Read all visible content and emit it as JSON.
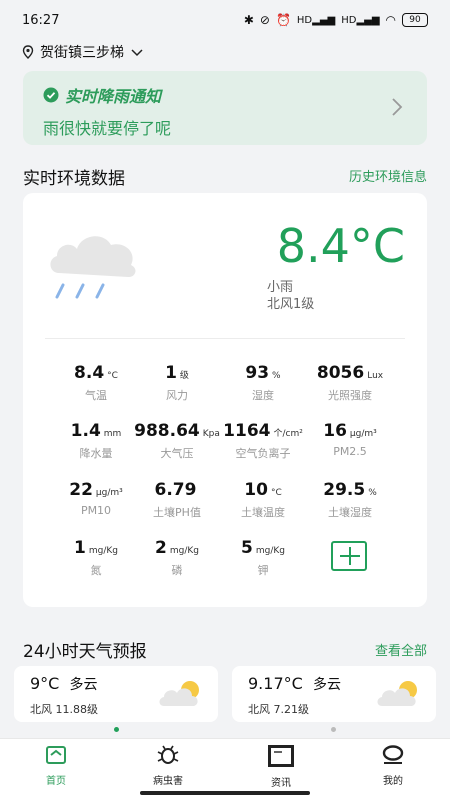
{
  "status": {
    "time": "16:27",
    "network_label": "HD",
    "battery": "90"
  },
  "location": {
    "name": "贺街镇三步梯"
  },
  "notice": {
    "title": "实时降雨通知",
    "text": "雨很快就要停了呢"
  },
  "env_section": {
    "title": "实时环境数据",
    "link": "历史环境信息"
  },
  "current": {
    "temperature": "8.4°C",
    "condition": "小雨",
    "wind": "北风1级"
  },
  "metrics": [
    {
      "value": "8.4",
      "unit": "°C",
      "label": "气温"
    },
    {
      "value": "1",
      "unit": "级",
      "label": "风力"
    },
    {
      "value": "93",
      "unit": "%",
      "label": "湿度"
    },
    {
      "value": "8056",
      "unit": "Lux",
      "label": "光照强度"
    },
    {
      "value": "1.4",
      "unit": "mm",
      "label": "降水量"
    },
    {
      "value": "988.64",
      "unit": "Kpa",
      "label": "大气压"
    },
    {
      "value": "1164",
      "unit": "个/cm²",
      "label": "空气负离子"
    },
    {
      "value": "16",
      "unit": "μg/m³",
      "label": "PM2.5"
    },
    {
      "value": "22",
      "unit": "μg/m³",
      "label": "PM10"
    },
    {
      "value": "6.79",
      "unit": "",
      "label": "土壤PH值"
    },
    {
      "value": "10",
      "unit": "°C",
      "label": "土壤温度"
    },
    {
      "value": "29.5",
      "unit": "%",
      "label": "土壤湿度"
    },
    {
      "value": "1",
      "unit": "mg/Kg",
      "label": "氮"
    },
    {
      "value": "2",
      "unit": "mg/Kg",
      "label": "磷"
    },
    {
      "value": "5",
      "unit": "mg/Kg",
      "label": "钾"
    }
  ],
  "forecast_section": {
    "title": "24小时天气预报",
    "link": "查看全部"
  },
  "forecast": [
    {
      "temp": "9°C",
      "condition": "多云",
      "wind": "北风 11.88级"
    },
    {
      "temp": "9.17°C",
      "condition": "多云",
      "wind": "北风 7.21级"
    }
  ],
  "tabs": [
    {
      "label": "首页",
      "icon": "home-icon"
    },
    {
      "label": "病虫害",
      "icon": "bug-icon"
    },
    {
      "label": "资讯",
      "icon": "news-icon"
    },
    {
      "label": "我的",
      "icon": "profile-icon"
    }
  ],
  "colors": {
    "accent": "#21a05a",
    "notice_bg": "#e2efe8"
  }
}
